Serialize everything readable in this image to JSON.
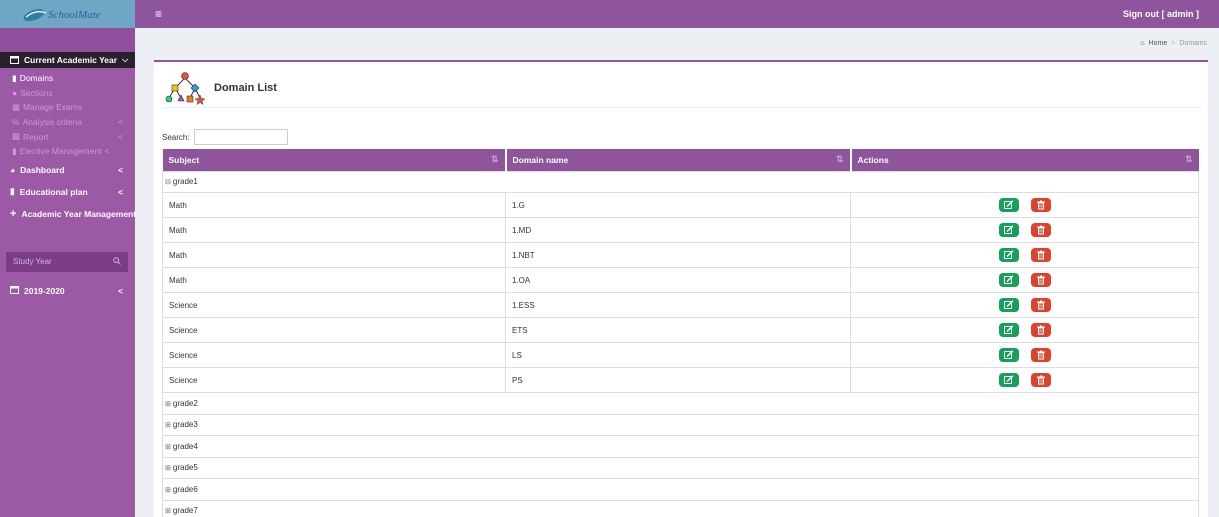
{
  "topbar": {
    "menu_icon": "hamburger-icon",
    "signout": "Sign out [ admin ]"
  },
  "sidebar": {
    "logo_text": "SchoolMate",
    "current_year_label": "Current Academic Year",
    "sub_items": [
      {
        "label": "Domains",
        "icon": "book-icon",
        "active": true
      },
      {
        "label": "Sections",
        "icon": "users-icon"
      },
      {
        "label": "Manage Exams",
        "icon": "table-icon"
      },
      {
        "label": "Analysis criteria",
        "icon": "percent-icon",
        "chevron": "<"
      },
      {
        "label": "Report",
        "icon": "bar-chart-icon",
        "chevron": "<"
      },
      {
        "label": "Elective Management",
        "icon": "book-icon",
        "chevron": "<"
      }
    ],
    "items": [
      {
        "label": "Dashboard",
        "icon": "dashboard-icon",
        "chevron": "<"
      },
      {
        "label": "Educational plan",
        "icon": "book-icon",
        "chevron": "<"
      },
      {
        "label": "Academic Year Management",
        "icon": "plus-icon"
      }
    ],
    "study_year_placeholder": "Study Year",
    "year_item": {
      "label": "2019-2020",
      "chevron": "<"
    }
  },
  "breadcrumb": {
    "home": "Home",
    "separator": ">",
    "current": "Domains"
  },
  "box": {
    "title": "Domain List",
    "icon": "hierarchy-icon"
  },
  "search": {
    "label": "Search:",
    "value": ""
  },
  "table": {
    "headers": [
      "Subject",
      "Domain name",
      "Actions"
    ],
    "groups": [
      {
        "name": "grade1",
        "expanded": true,
        "rows": [
          {
            "subject": "Math",
            "domain": "1.G"
          },
          {
            "subject": "Math",
            "domain": "1.MD"
          },
          {
            "subject": "Math",
            "domain": "1.NBT"
          },
          {
            "subject": "Math",
            "domain": "1.OA"
          },
          {
            "subject": "Science",
            "domain": "1.ESS"
          },
          {
            "subject": "Science",
            "domain": "ETS"
          },
          {
            "subject": "Science",
            "domain": "LS"
          },
          {
            "subject": "Science",
            "domain": "PS"
          }
        ]
      },
      {
        "name": "grade2",
        "expanded": false,
        "rows": []
      },
      {
        "name": "grade3",
        "expanded": false,
        "rows": []
      },
      {
        "name": "grade4",
        "expanded": false,
        "rows": []
      },
      {
        "name": "grade5",
        "expanded": false,
        "rows": []
      },
      {
        "name": "grade6",
        "expanded": false,
        "rows": []
      },
      {
        "name": "grade7",
        "expanded": false,
        "rows": []
      }
    ]
  },
  "colors": {
    "topbar": "#8e549c",
    "sidebar": "#9b59a6",
    "edit_button": "#16a05a",
    "delete_button": "#d9442f"
  }
}
